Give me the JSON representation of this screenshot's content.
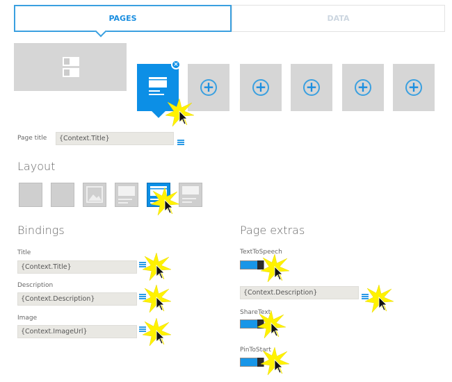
{
  "tabs": [
    {
      "label": "PAGES",
      "active": true
    },
    {
      "label": "DATA",
      "active": false
    }
  ],
  "page_title": {
    "label": "Page title",
    "value": "{Context.Title}"
  },
  "layout": {
    "heading": "Layout",
    "options": [
      "text-list",
      "text-list-2",
      "image",
      "header-text",
      "header-image-text",
      "header-text-2"
    ],
    "selected": 4
  },
  "bindings": {
    "heading": "Bindings",
    "fields": [
      {
        "label": "Title",
        "value": "{Context.Title}"
      },
      {
        "label": "Description",
        "value": "{Context.Description}"
      },
      {
        "label": "Image",
        "value": "{Context.ImageUrl}"
      }
    ]
  },
  "extras": {
    "heading": "Page extras",
    "tts": {
      "label": "TextToSpeech",
      "on": true,
      "value": "{Context.Description}"
    },
    "share": {
      "label": "ShareText",
      "on": true
    },
    "pin": {
      "label": "PinToStart",
      "on": true
    }
  },
  "colors": {
    "accent": "#0c8fe6",
    "highlight": "#ffee00"
  }
}
